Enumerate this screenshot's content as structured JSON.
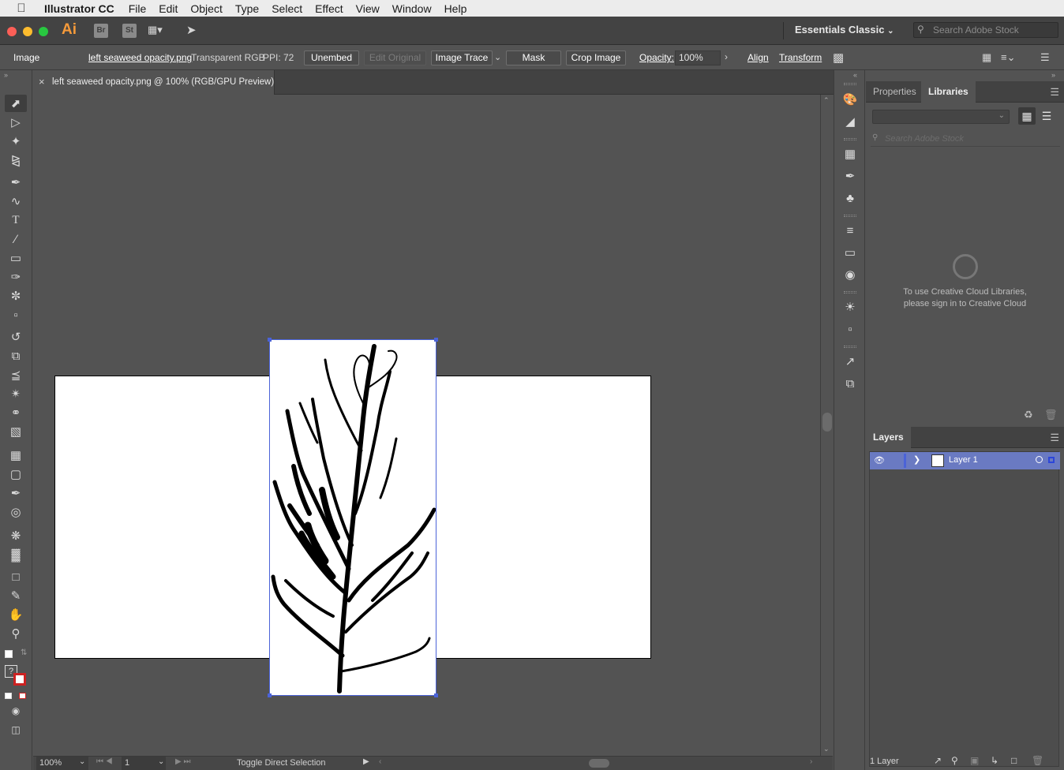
{
  "menubar": {
    "app": "Illustrator CC",
    "items": [
      "File",
      "Edit",
      "Object",
      "Type",
      "Select",
      "Effect",
      "View",
      "Window",
      "Help"
    ]
  },
  "appbar": {
    "logo": "Ai",
    "bridge": "Br",
    "stock": "St",
    "workspace": "Essentials Classic",
    "search_placeholder": "Search Adobe Stock"
  },
  "control": {
    "type": "Image",
    "filename": "left seaweed opacity.png",
    "color_mode": "Transparent RGB",
    "ppi": "PPI: 72",
    "unembed": "Unembed",
    "edit_original": "Edit Original",
    "image_trace": "Image Trace",
    "mask": "Mask",
    "crop": "Crop Image",
    "opacity_label": "Opacity:",
    "opacity_value": "100%",
    "align": "Align",
    "transform": "Transform"
  },
  "document": {
    "tab_title": "left seaweed opacity.png @ 100% (RGB/GPU Preview)"
  },
  "status": {
    "zoom": "100%",
    "page": "1",
    "tool_hint": "Toggle Direct Selection"
  },
  "panels": {
    "tabs": [
      "Properties",
      "Libraries"
    ],
    "active_tab": "Libraries",
    "library_search_placeholder": "Search Adobe Stock",
    "cc_message_line1": "To use Creative Cloud Libraries,",
    "cc_message_line2": "please sign in to Creative Cloud",
    "layers_title": "Layers",
    "layer_name": "Layer 1",
    "layer_count": "1 Layer"
  },
  "colors": {
    "selection": "#4b63d8",
    "ai_brand": "#f59a3a",
    "layer_highlight": "#6a7ac2"
  }
}
